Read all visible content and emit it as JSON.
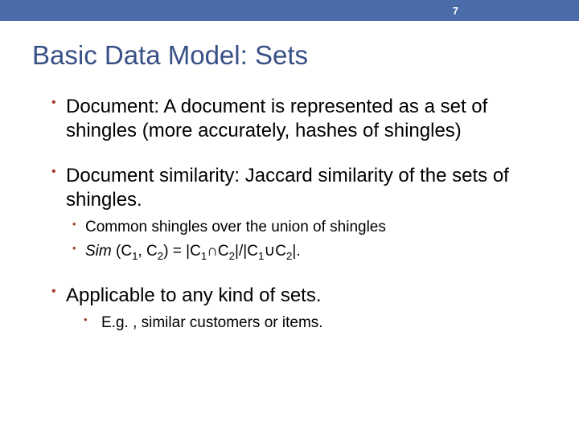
{
  "header": {
    "page": "7"
  },
  "title": "Basic Data Model: Sets",
  "bullets": [
    {
      "text": "Document: A document is represented as a set of shingles (more accurately, hashes of shingles)"
    },
    {
      "text": "Document similarity: Jaccard similarity of the sets of shingles.",
      "sub": [
        "Common shingles over the union of shingles"
      ],
      "formula": {
        "sim": "Sim",
        "po": " (",
        "C": "C",
        "s1": "1",
        "comma": ", ",
        "s2": "2",
        "eq": ") = |",
        "cap": "∩",
        "mid": "|/|",
        "cup": "∪",
        "end": "|."
      }
    },
    {
      "text": "Applicable to any kind of sets.",
      "sub": [
        "E.g. , similar customers or items."
      ]
    }
  ]
}
